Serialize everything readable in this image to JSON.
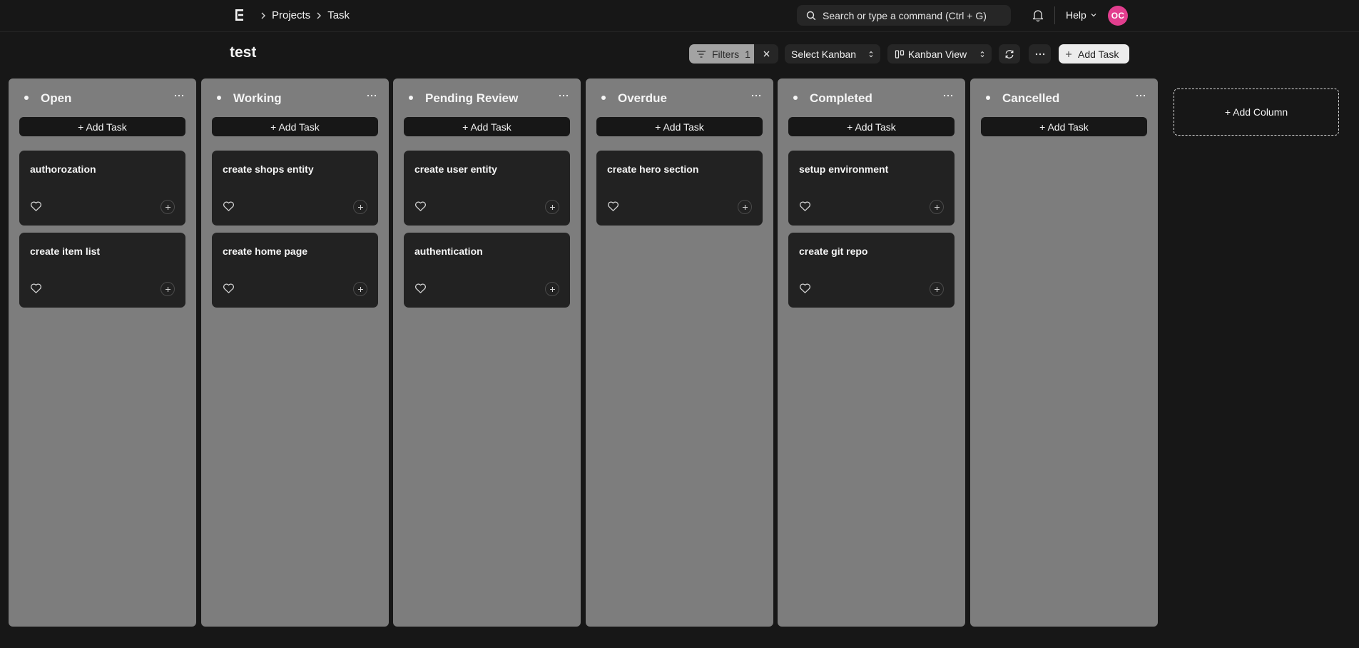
{
  "nav": {
    "breadcrumbs": [
      "Projects",
      "Task"
    ],
    "search_placeholder": "Search or type a command (Ctrl + G)",
    "help_label": "Help",
    "avatar_initials": "OC",
    "avatar_color": "#e23e8e"
  },
  "header": {
    "title": "test",
    "filters_label": "Filters",
    "filters_count": "1",
    "select_kanban_label": "Select Kanban",
    "kanban_view_label": "Kanban View",
    "add_task_label": "Add Task"
  },
  "board": {
    "add_task_label": "+ Add Task",
    "add_column_label": "+ Add Column",
    "columns": [
      {
        "title": "Open",
        "cards": [
          "authorozation",
          "create item list"
        ]
      },
      {
        "title": "Working",
        "cards": [
          "create shops entity",
          "create home page"
        ]
      },
      {
        "title": "Pending Review",
        "cards": [
          "create user entity",
          "authentication"
        ]
      },
      {
        "title": "Overdue",
        "cards": [
          "create hero section"
        ]
      },
      {
        "title": "Completed",
        "cards": [
          "setup environment",
          "create git repo"
        ]
      },
      {
        "title": "Cancelled",
        "cards": []
      }
    ]
  }
}
